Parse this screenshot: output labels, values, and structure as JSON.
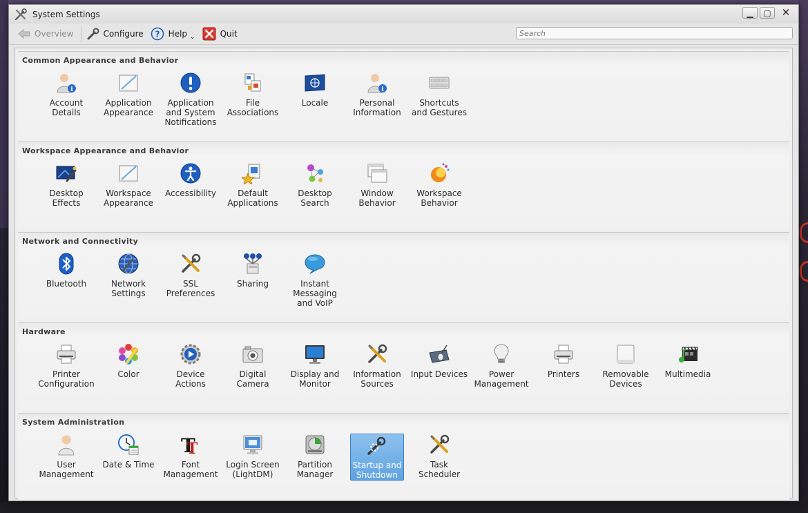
{
  "window": {
    "title": "System Settings",
    "controls": {
      "minimize": "▁",
      "maximize": "▢",
      "close": "✕"
    }
  },
  "toolbar": {
    "overview_label": "Overview",
    "configure_label": "Configure",
    "help_label": "Help",
    "quit_label": "Quit"
  },
  "search": {
    "placeholder": "Search"
  },
  "colors": {
    "selection": "#5fa3e0",
    "window_bg": "#e6e6e6",
    "content_bg": "#efefef"
  },
  "groups": [
    {
      "title": "Common Appearance and Behavior",
      "items": [
        {
          "label": "Account\nDetails",
          "icon": "account-icon"
        },
        {
          "label": "Application\nAppearance",
          "icon": "appearance-icon"
        },
        {
          "label": "Application\nand System\nNotifications",
          "icon": "notifications-icon"
        },
        {
          "label": "File\nAssociations",
          "icon": "file-associations-icon"
        },
        {
          "label": "Locale",
          "icon": "locale-flag-icon"
        },
        {
          "label": "Personal\nInformation",
          "icon": "personal-info-icon"
        },
        {
          "label": "Shortcuts\nand Gestures",
          "icon": "keyboard-icon"
        }
      ]
    },
    {
      "title": "Workspace Appearance and Behavior",
      "items": [
        {
          "label": "Desktop\nEffects",
          "icon": "desktop-effects-icon"
        },
        {
          "label": "Workspace\nAppearance",
          "icon": "workspace-appearance-icon"
        },
        {
          "label": "Accessibility",
          "icon": "accessibility-icon"
        },
        {
          "label": "Default\nApplications",
          "icon": "default-apps-icon"
        },
        {
          "label": "Desktop\nSearch",
          "icon": "desktop-search-icon"
        },
        {
          "label": "Window\nBehavior",
          "icon": "window-behavior-icon"
        },
        {
          "label": "Workspace\nBehavior",
          "icon": "workspace-behavior-icon"
        }
      ]
    },
    {
      "title": "Network and Connectivity",
      "items": [
        {
          "label": "Bluetooth",
          "icon": "bluetooth-icon"
        },
        {
          "label": "Network\nSettings",
          "icon": "network-globe-icon"
        },
        {
          "label": "SSL\nPreferences",
          "icon": "tools-icon"
        },
        {
          "label": "Sharing",
          "icon": "sharing-icon"
        },
        {
          "label": "Instant\nMessaging\nand VoIP",
          "icon": "chat-bubble-icon"
        }
      ]
    },
    {
      "title": "Hardware",
      "items": [
        {
          "label": "Printer\nConfiguration",
          "icon": "printer-icon"
        },
        {
          "label": "Color",
          "icon": "color-icon"
        },
        {
          "label": "Device\nActions",
          "icon": "device-actions-icon"
        },
        {
          "label": "Digital\nCamera",
          "icon": "camera-icon"
        },
        {
          "label": "Display and\nMonitor",
          "icon": "monitor-icon"
        },
        {
          "label": "Information\nSources",
          "icon": "tools-icon"
        },
        {
          "label": "Input Devices",
          "icon": "input-devices-icon"
        },
        {
          "label": "Power\nManagement",
          "icon": "lightbulb-icon"
        },
        {
          "label": "Printers",
          "icon": "printer-icon"
        },
        {
          "label": "Removable\nDevices",
          "icon": "removable-drive-icon"
        },
        {
          "label": "Multimedia",
          "icon": "multimedia-icon"
        }
      ]
    },
    {
      "title": "System Administration",
      "items": [
        {
          "label": "User\nManagement",
          "icon": "user-icon"
        },
        {
          "label": "Date & Time",
          "icon": "clock-calendar-icon"
        },
        {
          "label": "Font\nManagement",
          "icon": "font-icon"
        },
        {
          "label": "Login Screen\n(LightDM)",
          "icon": "login-screen-icon"
        },
        {
          "label": "Partition\nManager",
          "icon": "disk-icon"
        },
        {
          "label": "Startup and\nShutdown",
          "icon": "startup-icon",
          "selected": true
        },
        {
          "label": "Task\nScheduler",
          "icon": "tools-icon"
        }
      ]
    }
  ]
}
